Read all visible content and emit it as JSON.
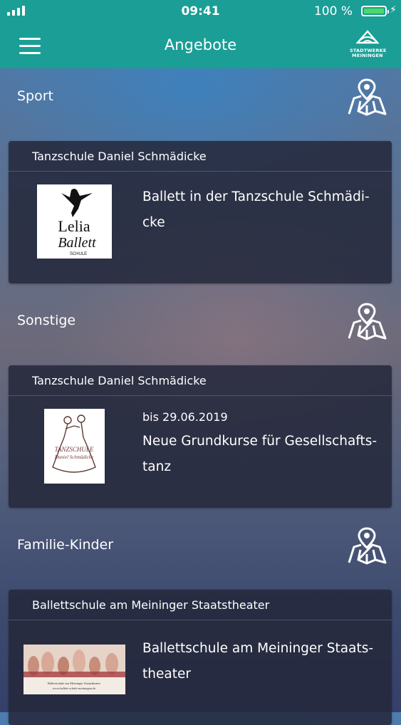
{
  "status_bar": {
    "time": "09:41",
    "battery": "100 %",
    "battery_color": "#4cd964"
  },
  "nav": {
    "title": "Angebote",
    "logo_line1": "STADTWERKE",
    "logo_line2": "MEININGEN",
    "bar_color": "#1a9e96"
  },
  "sections": [
    {
      "title": "Sport",
      "card": {
        "provider": "Tanzschule Daniel Schmädicke",
        "date": "",
        "title_line1": "Ballett in der Tanzschule Schmädi-",
        "title_line2": "cke",
        "logo_text1": "Lelia",
        "logo_text2": "Ballett",
        "logo_text3": "SCHULE"
      }
    },
    {
      "title": "Sonstige",
      "card": {
        "provider": "Tanzschule Daniel Schmädicke",
        "date": "bis 29.06.2019",
        "title_line1": "Neue Grundkurse für Gesellschafts-",
        "title_line2": "tanz",
        "logo_text1": "TANZSCHULE",
        "logo_text2": "Daniel Schmädicke"
      }
    },
    {
      "title": "Familie-Kinder",
      "card": {
        "provider": "Ballettschule am Meininger Staatstheater",
        "date": "",
        "title_line1": "Ballettschule am Meininger Staats-",
        "title_line2": "theater",
        "logo_text1": "Ballettschule am Meininger Staatstheater",
        "logo_text2": "www.ballett-schule-meiningen.de"
      }
    }
  ]
}
